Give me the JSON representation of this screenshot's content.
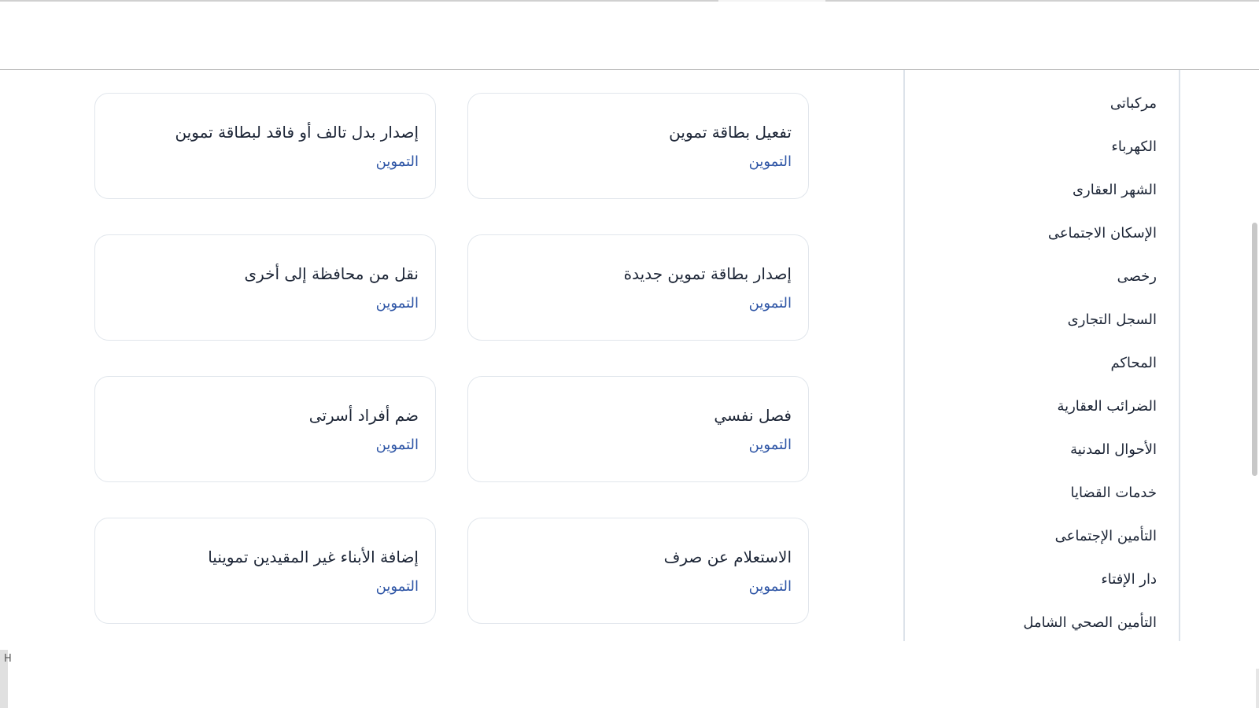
{
  "sidebar": {
    "items": [
      {
        "label": "ـ"
      },
      {
        "label": "مركباتى"
      },
      {
        "label": "الكهرباء"
      },
      {
        "label": "الشهر العقارى"
      },
      {
        "label": "الإسكان الاجتماعى"
      },
      {
        "label": "رخصى"
      },
      {
        "label": "السجل التجارى"
      },
      {
        "label": "المحاكم"
      },
      {
        "label": "الضرائب العقارية"
      },
      {
        "label": "الأحوال المدنية"
      },
      {
        "label": "خدمات القضايا"
      },
      {
        "label": "التأمين الإجتماعى"
      },
      {
        "label": "دار الإفتاء"
      },
      {
        "label": "التأمين الصحي الشامل"
      }
    ]
  },
  "cards": [
    {
      "title": "تفعيل بطاقة تموين",
      "category": "التموين"
    },
    {
      "title": "إصدار بدل تالف أو فاقد لبطاقة تموين",
      "category": "التموين"
    },
    {
      "title": "إصدار بطاقة تموين جديدة",
      "category": "التموين"
    },
    {
      "title": "نقل من محافظة إلى أخرى",
      "category": "التموين"
    },
    {
      "title": "فصل نفسي",
      "category": "التموين"
    },
    {
      "title": "ضم أفراد أسرتى",
      "category": "التموين"
    },
    {
      "title": "الاستعلام عن صرف",
      "category": "التموين"
    },
    {
      "title": "إضافة الأبناء غير المقيدين تموينيا",
      "category": "التموين"
    }
  ],
  "footer": {
    "corner_char": "H"
  },
  "colors": {
    "title_text": "#1c2536",
    "category_text": "#2f56a6",
    "card_border": "#e1e6ec",
    "sidebar_border": "#dde3ea"
  }
}
